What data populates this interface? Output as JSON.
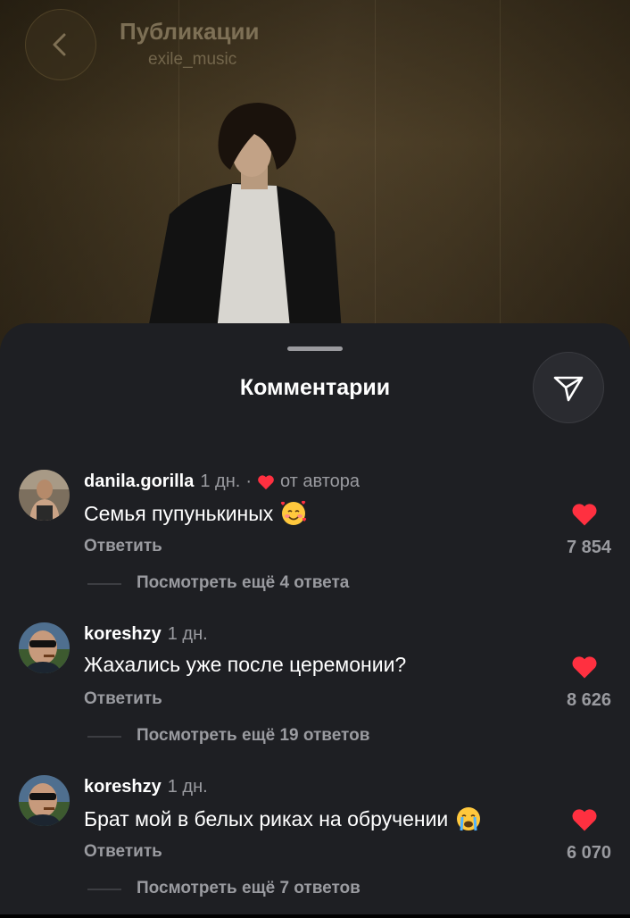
{
  "header": {
    "title": "Публикации",
    "subtitle": "exile_music",
    "back_icon": "chevron-left-icon"
  },
  "sheet": {
    "title": "Комментарии",
    "share_icon": "send-icon"
  },
  "comments": [
    {
      "user": "danila.gorilla",
      "time": "1 дн.",
      "separator": "·",
      "author_badge": "от автора",
      "text": "Семья пупунькиных",
      "emoji": "smiling-face-with-hearts-emoji",
      "reply": "Ответить",
      "likes": "7 854",
      "more": "Посмотреть ещё 4 ответа"
    },
    {
      "user": "koreshzy",
      "time": "1 дн.",
      "text": "Жахались уже после церемонии?",
      "reply": "Ответить",
      "likes": "8 626",
      "more": "Посмотреть ещё 19 ответов"
    },
    {
      "user": "koreshzy",
      "time": "1 дн.",
      "text": "Брат мой в белых риках на обручении",
      "emoji": "loudly-crying-face-emoji",
      "reply": "Ответить",
      "likes": "6 070",
      "more": "Посмотреть ещё 7 ответов"
    }
  ],
  "colors": {
    "sheet_bg": "#1e1f23",
    "like_red": "#ff3040",
    "muted_text": "#9a9ba0"
  }
}
